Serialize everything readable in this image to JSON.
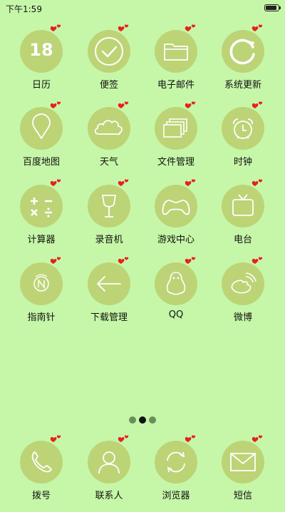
{
  "status_bar": {
    "time": "下午1:59"
  },
  "apps": [
    {
      "label": "日历",
      "icon": "calendar-icon",
      "date_number": "18"
    },
    {
      "label": "便签",
      "icon": "checkmark-icon"
    },
    {
      "label": "电子邮件",
      "icon": "folder-icon"
    },
    {
      "label": "系统更新",
      "icon": "refresh-icon"
    },
    {
      "label": "百度地图",
      "icon": "map-pin-icon"
    },
    {
      "label": "天气",
      "icon": "cloud-icon"
    },
    {
      "label": "文件管理",
      "icon": "files-icon"
    },
    {
      "label": "时钟",
      "icon": "alarm-clock-icon"
    },
    {
      "label": "计算器",
      "icon": "calculator-icon"
    },
    {
      "label": "录音机",
      "icon": "glass-icon"
    },
    {
      "label": "游戏中心",
      "icon": "gamepad-icon"
    },
    {
      "label": "电台",
      "icon": "tv-icon"
    },
    {
      "label": "指南针",
      "icon": "compass-icon"
    },
    {
      "label": "下载管理",
      "icon": "arrow-left-icon"
    },
    {
      "label": "QQ",
      "icon": "penguin-icon"
    },
    {
      "label": "微博",
      "icon": "weibo-icon"
    }
  ],
  "page_indicator": {
    "pages": 3,
    "active": 2
  },
  "dock": [
    {
      "label": "拨号",
      "icon": "phone-icon"
    },
    {
      "label": "联系人",
      "icon": "person-icon"
    },
    {
      "label": "浏览器",
      "icon": "sync-arrows-icon"
    },
    {
      "label": "短信",
      "icon": "envelope-icon"
    }
  ],
  "colors": {
    "background": "#c6f7a8",
    "icon_circle": "#bcd476",
    "heart": "#e8201e"
  }
}
